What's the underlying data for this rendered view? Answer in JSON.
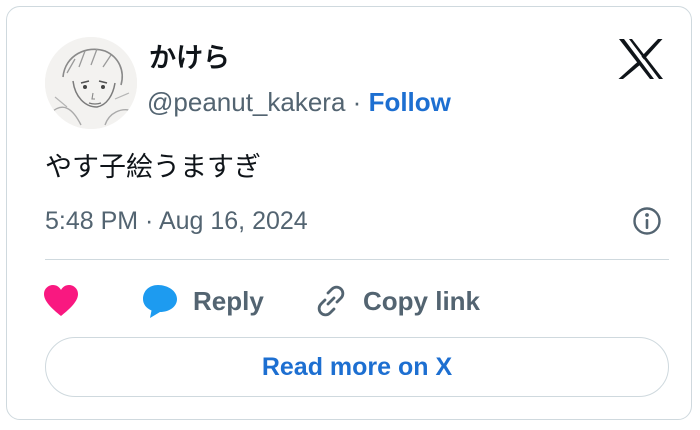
{
  "author": {
    "display_name": "かけら",
    "handle": "@peanut_kakera",
    "separator": "·",
    "follow_label": "Follow",
    "avatar_icon": "sketch-portrait-avatar"
  },
  "tweet": {
    "text": "やす子絵うますぎ",
    "timestamp": "5:48 PM · Aug 16, 2024"
  },
  "actions": {
    "like_icon": "heart-icon",
    "like_color": "#f91880",
    "reply_label": "Reply",
    "reply_icon": "speech-bubble-icon",
    "reply_color": "#1d9bf0",
    "copy_label": "Copy link",
    "copy_icon": "link-icon"
  },
  "footer": {
    "read_more_label": "Read more on X"
  },
  "colors": {
    "accent": "#1d6fd1",
    "secondary_text": "#536471",
    "border": "#cfd9de"
  }
}
